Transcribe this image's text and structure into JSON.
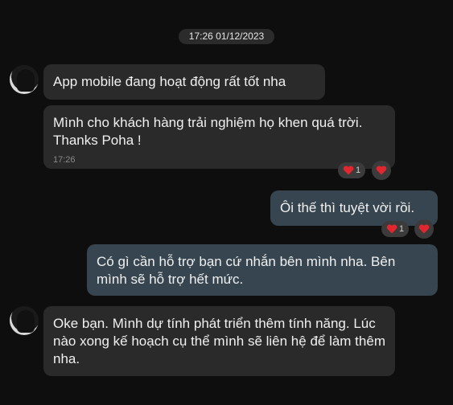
{
  "timestamp": "17:26 01/12/2023",
  "messages": [
    {
      "text": "App mobile đang hoạt động rất tốt nha"
    },
    {
      "text": "Mình cho khách hàng trải nghiệm họ khen quá trời. Thanks Poha !",
      "time": "17:26"
    },
    {
      "text": "Ôi thế thì tuyệt vời rồi."
    },
    {
      "text": "Có gì cần hỗ trợ bạn cứ nhắn bên mình nha. Bên mình sẽ hỗ trợ hết mức."
    },
    {
      "text": "Oke bạn. Mình dự tính phát triển thêm tính năng. Lúc nào xong kế hoạch cụ thể mình sẽ liên hệ để làm thêm nha."
    }
  ],
  "reactions": [
    {
      "emoji": "heart-icon",
      "count": "1"
    },
    {
      "emoji": "heart-icon",
      "count": "1"
    }
  ],
  "colors": {
    "background": "#0e0e0e",
    "incoming_bubble": "#2a2a2a",
    "outgoing_bubble": "#36454f",
    "heart": "#e0262f"
  }
}
